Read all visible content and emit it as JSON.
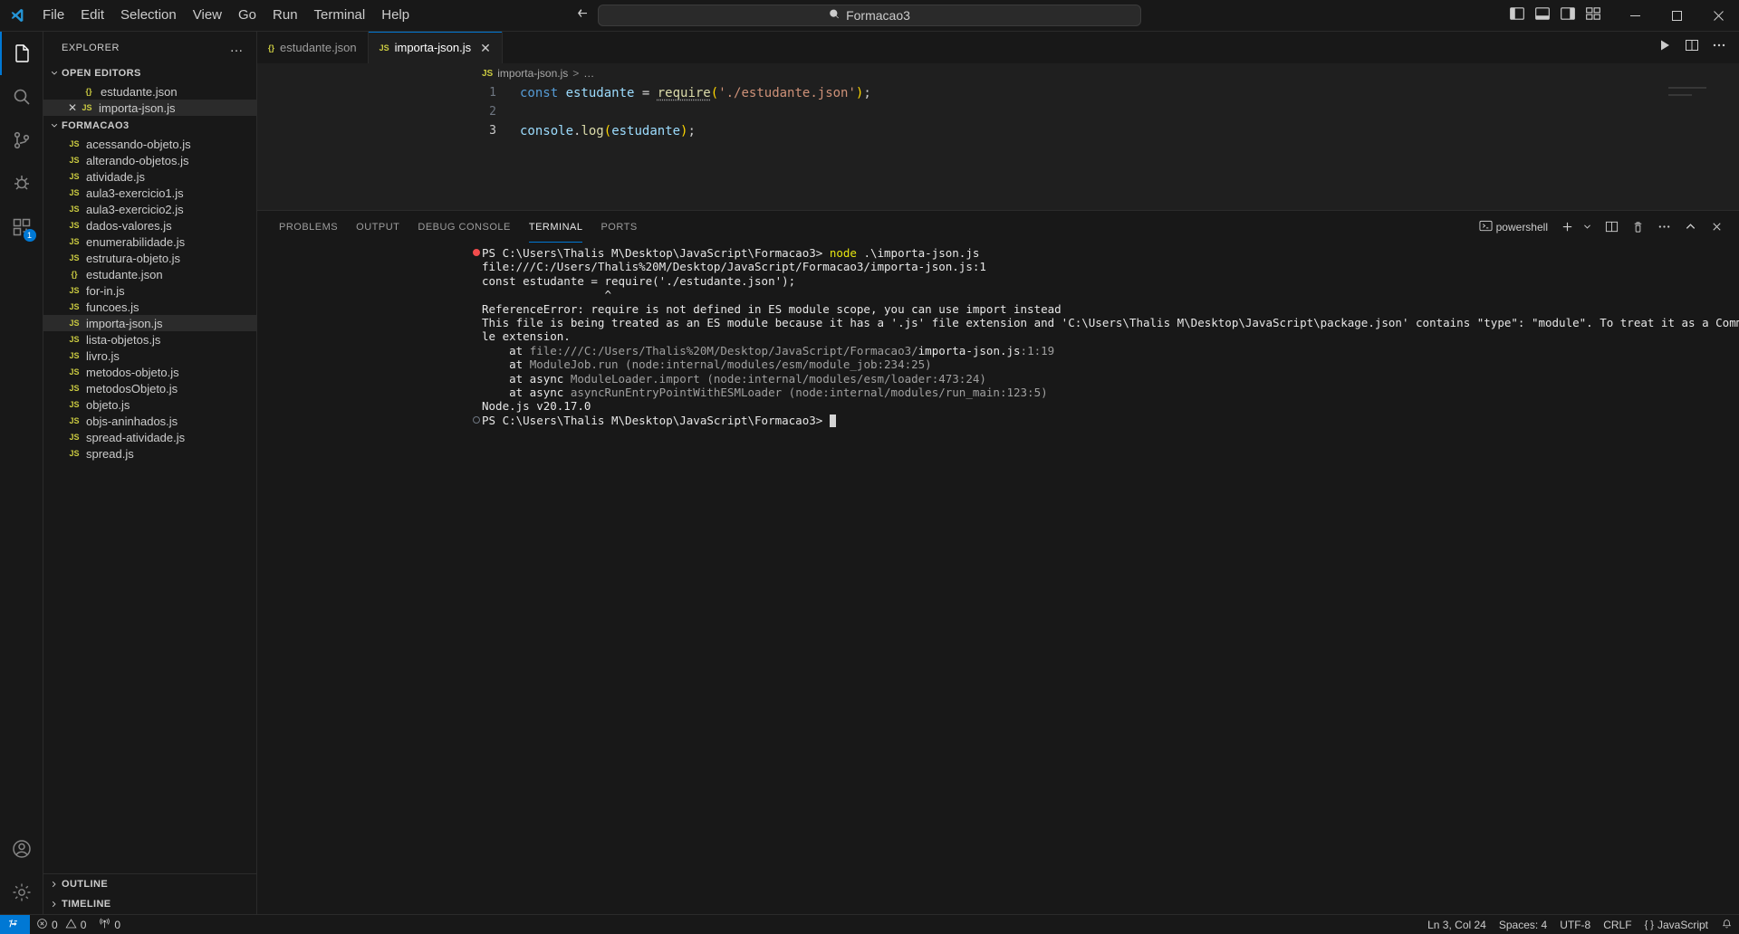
{
  "titlebar": {
    "menus": [
      "File",
      "Edit",
      "Selection",
      "View",
      "Go",
      "Run",
      "Terminal",
      "Help"
    ],
    "command_center_text": "Formacao3",
    "search_icon": "search-icon",
    "back_icon": "arrow-left-icon",
    "forward_icon": "arrow-right-icon",
    "layout_icons": [
      "toggle-primary-sidebar-icon",
      "toggle-panel-icon",
      "toggle-secondary-sidebar-icon",
      "customize-layout-icon"
    ],
    "window_controls": [
      "minimize",
      "maximize",
      "close"
    ]
  },
  "activitybar": {
    "items": [
      {
        "name": "explorer",
        "icon": "files-icon",
        "active": true,
        "badge": ""
      },
      {
        "name": "search",
        "icon": "search-icon",
        "active": false,
        "badge": ""
      },
      {
        "name": "source-control",
        "icon": "source-control-icon",
        "active": false,
        "badge": ""
      },
      {
        "name": "run-and-debug",
        "icon": "debug-icon",
        "active": false,
        "badge": ""
      },
      {
        "name": "extensions",
        "icon": "extensions-icon",
        "active": false,
        "badge": "1"
      }
    ],
    "bottom": [
      {
        "name": "accounts",
        "icon": "account-icon"
      },
      {
        "name": "manage",
        "icon": "gear-icon"
      }
    ]
  },
  "sidebar": {
    "title": "EXPLORER",
    "more_actions": "…",
    "open_editors": {
      "label": "OPEN EDITORS",
      "items": [
        {
          "label": "estudante.json",
          "icon": "json-file-icon",
          "selected": false,
          "has_close": false
        },
        {
          "label": "importa-json.js",
          "icon": "js-file-icon",
          "selected": true,
          "has_close": true
        }
      ]
    },
    "folder": {
      "label": "FORMACAO3",
      "files": [
        {
          "label": "acessando-objeto.js",
          "icon": "js-file-icon",
          "selected": false
        },
        {
          "label": "alterando-objetos.js",
          "icon": "js-file-icon",
          "selected": false
        },
        {
          "label": "atividade.js",
          "icon": "js-file-icon",
          "selected": false
        },
        {
          "label": "aula3-exercicio1.js",
          "icon": "js-file-icon",
          "selected": false
        },
        {
          "label": "aula3-exercicio2.js",
          "icon": "js-file-icon",
          "selected": false
        },
        {
          "label": "dados-valores.js",
          "icon": "js-file-icon",
          "selected": false
        },
        {
          "label": "enumerabilidade.js",
          "icon": "js-file-icon",
          "selected": false
        },
        {
          "label": "estrutura-objeto.js",
          "icon": "js-file-icon",
          "selected": false
        },
        {
          "label": "estudante.json",
          "icon": "json-file-icon",
          "selected": false
        },
        {
          "label": "for-in.js",
          "icon": "js-file-icon",
          "selected": false
        },
        {
          "label": "funcoes.js",
          "icon": "js-file-icon",
          "selected": false
        },
        {
          "label": "importa-json.js",
          "icon": "js-file-icon",
          "selected": true
        },
        {
          "label": "lista-objetos.js",
          "icon": "js-file-icon",
          "selected": false
        },
        {
          "label": "livro.js",
          "icon": "js-file-icon",
          "selected": false
        },
        {
          "label": "metodos-objeto.js",
          "icon": "js-file-icon",
          "selected": false
        },
        {
          "label": "metodosObjeto.js",
          "icon": "js-file-icon",
          "selected": false
        },
        {
          "label": "objeto.js",
          "icon": "js-file-icon",
          "selected": false
        },
        {
          "label": "objs-aninhados.js",
          "icon": "js-file-icon",
          "selected": false
        },
        {
          "label": "spread-atividade.js",
          "icon": "js-file-icon",
          "selected": false
        },
        {
          "label": "spread.js",
          "icon": "js-file-icon",
          "selected": false
        }
      ]
    },
    "outline_label": "OUTLINE",
    "timeline_label": "TIMELINE"
  },
  "editor": {
    "tabs": [
      {
        "label": "estudante.json",
        "icon": "json-file-icon",
        "active": false,
        "closable": false
      },
      {
        "label": "importa-json.js",
        "icon": "js-file-icon",
        "active": true,
        "closable": true
      }
    ],
    "actions": [
      "run-icon",
      "split-editor-icon",
      "more-actions-icon"
    ],
    "breadcrumb": {
      "file": "importa-json.js",
      "separator": ">",
      "tail": "…"
    },
    "lines": [
      {
        "num": "1",
        "tokens": [
          {
            "t": "const ",
            "c": "t-kw"
          },
          {
            "t": "estudante ",
            "c": "t-var"
          },
          {
            "t": "= ",
            "c": "t-op"
          },
          {
            "t": "require",
            "c": "t-fn squiggle"
          },
          {
            "t": "(",
            "c": "t-paren"
          },
          {
            "t": "'./estudante.json'",
            "c": "t-str"
          },
          {
            "t": ")",
            "c": "t-paren"
          },
          {
            "t": ";",
            "c": "t-punc"
          }
        ]
      },
      {
        "num": "2",
        "tokens": []
      },
      {
        "num": "3",
        "active": true,
        "tokens": [
          {
            "t": "console",
            "c": "t-var"
          },
          {
            "t": ".",
            "c": "t-punc"
          },
          {
            "t": "log",
            "c": "t-fn"
          },
          {
            "t": "(",
            "c": "t-paren"
          },
          {
            "t": "estudante",
            "c": "t-var"
          },
          {
            "t": ")",
            "c": "t-paren"
          },
          {
            "t": ";",
            "c": "t-punc"
          }
        ]
      }
    ]
  },
  "panel": {
    "tabs": [
      {
        "label": "PROBLEMS",
        "active": false
      },
      {
        "label": "OUTPUT",
        "active": false
      },
      {
        "label": "DEBUG CONSOLE",
        "active": false
      },
      {
        "label": "TERMINAL",
        "active": true
      },
      {
        "label": "PORTS",
        "active": false
      }
    ],
    "shell_label": "powershell",
    "shell_icon": "terminal-powershell-icon",
    "actions": [
      "new-terminal-icon",
      "chevron-down-icon",
      "split-terminal-icon",
      "kill-terminal-icon",
      "more-actions-icon",
      "maximize-panel-icon",
      "close-panel-icon"
    ]
  },
  "terminal": {
    "lines": [
      {
        "mark": "error",
        "segments": [
          {
            "t": "PS C:\\Users\\Thalis M\\Desktop\\JavaScript\\Formacao3> ",
            "c": "c-white"
          },
          {
            "t": "node ",
            "c": "c-yellow"
          },
          {
            "t": ".\\importa-json.js",
            "c": "c-white"
          }
        ]
      },
      {
        "segments": [
          {
            "t": "file:///C:/Users/Thalis%20M/Desktop/JavaScript/Formacao3/importa-json.js:1",
            "c": "c-white"
          }
        ]
      },
      {
        "segments": [
          {
            "t": "const estudante = require('./estudante.json');",
            "c": "c-white"
          }
        ]
      },
      {
        "segments": [
          {
            "t": "                  ^",
            "c": "c-white"
          }
        ]
      },
      {
        "segments": [
          {
            "t": "",
            "c": "c-white"
          }
        ]
      },
      {
        "segments": [
          {
            "t": "ReferenceError: require is not defined in ES module scope, you can use import instead",
            "c": "c-white"
          }
        ]
      },
      {
        "segments": [
          {
            "t": "This file is being treated as an ES module because it has a '.js' file extension and 'C:\\Users\\Thalis M\\Desktop\\JavaScript\\package.json' contains \"type\": \"module\". To treat it as a CommonJS script, rename it to use the '.cjs' fi",
            "c": "c-white"
          }
        ]
      },
      {
        "segments": [
          {
            "t": "le extension.",
            "c": "c-white"
          }
        ]
      },
      {
        "segments": [
          {
            "t": "    at ",
            "c": "c-white"
          },
          {
            "t": "file:///C:/Users/Thalis%20M/Desktop/JavaScript/Formacao3/",
            "c": "c-gray"
          },
          {
            "t": "importa-json.js",
            "c": "c-white"
          },
          {
            "t": ":1:19",
            "c": "c-gray"
          }
        ]
      },
      {
        "segments": [
          {
            "t": "    at ",
            "c": "c-white"
          },
          {
            "t": "ModuleJob.run (node:internal/modules/esm/module_job:234:25)",
            "c": "c-gray"
          }
        ]
      },
      {
        "segments": [
          {
            "t": "    at async ",
            "c": "c-white"
          },
          {
            "t": "ModuleLoader.import (node:internal/modules/esm/loader:473:24)",
            "c": "c-gray"
          }
        ]
      },
      {
        "segments": [
          {
            "t": "    at async ",
            "c": "c-white"
          },
          {
            "t": "asyncRunEntryPointWithESMLoader (node:internal/modules/run_main:123:5)",
            "c": "c-gray"
          }
        ]
      },
      {
        "segments": [
          {
            "t": "",
            "c": "c-white"
          }
        ]
      },
      {
        "segments": [
          {
            "t": "Node.js v20.17.0",
            "c": "c-white"
          }
        ]
      },
      {
        "mark": "prompt",
        "segments": [
          {
            "t": "PS C:\\Users\\Thalis M\\Desktop\\JavaScript\\Formacao3> ",
            "c": "c-white"
          }
        ],
        "cursor": true
      }
    ]
  },
  "statusbar": {
    "remote_label": "",
    "remote_icon": "remote-window-icon",
    "errors": "0",
    "warnings": "0",
    "ports": "0",
    "error_icon": "error-icon",
    "warning_icon": "warning-icon",
    "radio_icon": "radio-tower-icon",
    "cursor_position": "Ln 3, Col 24",
    "indentation": "Spaces: 4",
    "encoding": "UTF-8",
    "eol": "CRLF",
    "language": "JavaScript",
    "language_icon": "json-braces-icon",
    "bell_icon": "bell-icon"
  },
  "colors": {
    "accent": "#0078d4",
    "bg": "#1f1f1f",
    "chrome": "#181818",
    "error": "#f14c4c",
    "js_yellow": "#cbcb41"
  }
}
